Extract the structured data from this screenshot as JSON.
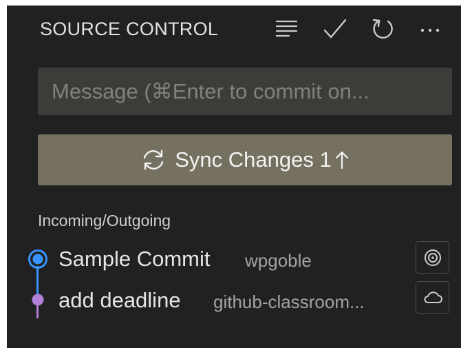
{
  "header": {
    "title": "SOURCE CONTROL",
    "actions": [
      {
        "icon": "view-as-tree-icon"
      },
      {
        "icon": "commit-check-icon"
      },
      {
        "icon": "refresh-icon"
      },
      {
        "icon": "more-actions-icon"
      }
    ]
  },
  "commit_input": {
    "placeholder": "Message (⌘Enter to commit on...",
    "value": ""
  },
  "sync_button": {
    "label": "Sync Changes 1",
    "icon": "sync-icon",
    "arrow_icon": "arrow-up-icon"
  },
  "section": {
    "title": "Incoming/Outgoing"
  },
  "commits": [
    {
      "title": "Sample Commit",
      "author": "wpgoble",
      "action_icon": "target-icon",
      "node_color": "#3794ff"
    },
    {
      "title": "add deadline",
      "author": "github-classroom...",
      "action_icon": "cloud-icon",
      "node_color": "#b180d7"
    }
  ],
  "colors": {
    "panel_bg": "#212121",
    "input_bg": "#3b3d39",
    "button_bg": "#75705f",
    "outgoing_blue": "#3794ff",
    "incoming_purple": "#b180d7"
  }
}
